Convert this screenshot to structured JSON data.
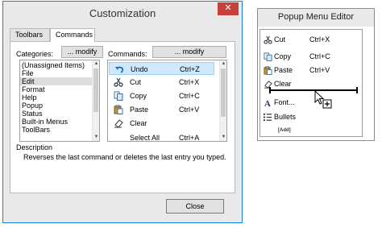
{
  "customization": {
    "title": "Customization",
    "close_glyph": "✕",
    "tabs": [
      {
        "label": "Toolbars"
      },
      {
        "label": "Commands"
      }
    ],
    "categories_label": "Categories:",
    "commands_label": "Commands:",
    "categories_modify_label": "... modify",
    "commands_modify_label": "... modify",
    "categories": [
      {
        "label": "(Unassigned Items)",
        "selected": false
      },
      {
        "label": "File",
        "selected": false
      },
      {
        "label": "Edit",
        "selected": true
      },
      {
        "label": "Format",
        "selected": false
      },
      {
        "label": "Help",
        "selected": false
      },
      {
        "label": "Popup",
        "selected": false
      },
      {
        "label": "Status",
        "selected": false
      },
      {
        "label": "Built-in Menus",
        "selected": false
      },
      {
        "label": "ToolBars",
        "selected": false
      }
    ],
    "commands": [
      {
        "label": "Undo",
        "shortcut": "Ctrl+Z",
        "icon": "undo-icon",
        "selected": true
      },
      {
        "label": "Cut",
        "shortcut": "Ctrl+X",
        "icon": "scissors-icon",
        "selected": false
      },
      {
        "label": "Copy",
        "shortcut": "Ctrl+C",
        "icon": "copy-icon",
        "selected": false
      },
      {
        "label": "Paste",
        "shortcut": "Ctrl+V",
        "icon": "paste-icon",
        "selected": false
      },
      {
        "label": "Clear",
        "shortcut": "",
        "icon": "eraser-icon",
        "selected": false
      },
      {
        "label": "Select All",
        "shortcut": "Ctrl+A",
        "icon": "",
        "selected": false
      }
    ],
    "description_label": "Description",
    "description_text": "Reverses the last command or deletes the last entry you typed.",
    "close_button_label": "Close"
  },
  "popup_editor": {
    "title": "Popup Menu Editor",
    "items": [
      {
        "label": "Cut",
        "shortcut": "Ctrl+X",
        "icon": "scissors-icon"
      },
      {
        "label": "Copy",
        "shortcut": "Ctrl+C",
        "icon": "copy-icon"
      },
      {
        "label": "Paste",
        "shortcut": "Ctrl+V",
        "icon": "paste-icon"
      },
      {
        "label": "Clear",
        "shortcut": "",
        "icon": "eraser-icon"
      },
      {
        "label": "Font...",
        "shortcut": "",
        "icon": "font-icon"
      },
      {
        "label": "Bullets",
        "shortcut": "",
        "icon": "bullets-icon"
      }
    ],
    "add_label": "[Add]"
  },
  "colors": {
    "title_border": "#1882d7",
    "close_red": "#c7413a",
    "selection": "#cde8ff"
  }
}
